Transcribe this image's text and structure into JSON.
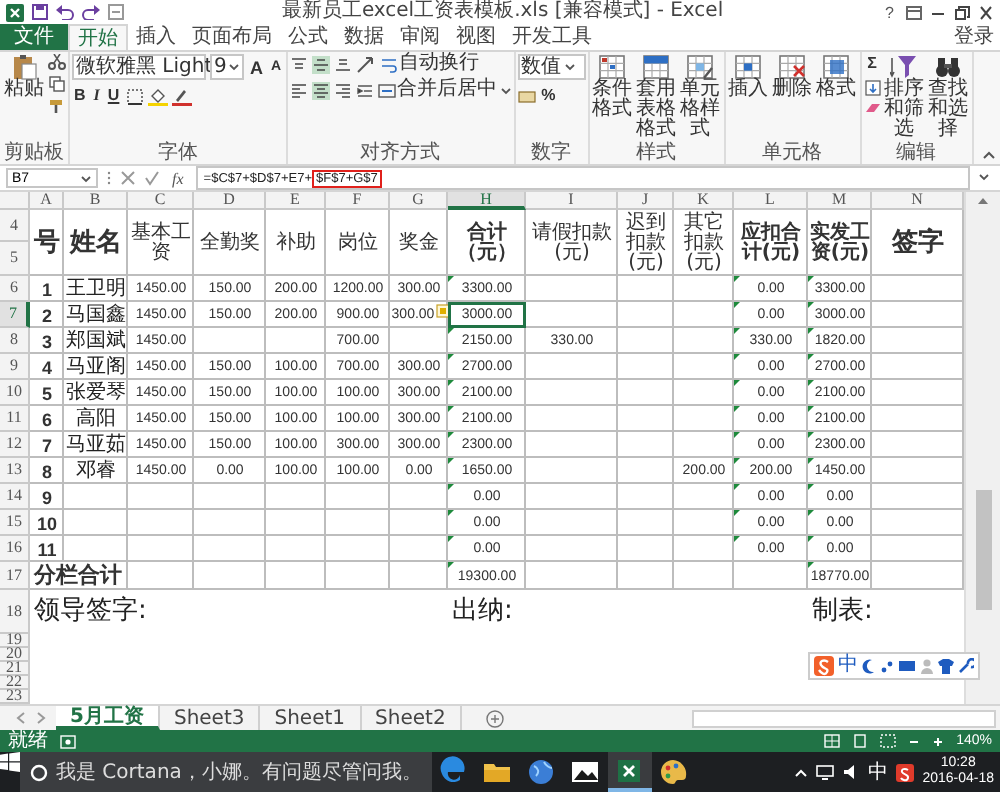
{
  "window": {
    "title": "最新员工excel工资表模板.xls [兼容模式] - Excel",
    "help": "?"
  },
  "ribbon": {
    "tabs": [
      {
        "label": "文件",
        "kind": "file",
        "selected": false
      },
      {
        "label": "开始",
        "kind": "tab",
        "selected": true
      },
      {
        "label": "插入",
        "kind": "tab",
        "selected": false
      },
      {
        "label": "页面布局",
        "kind": "tab",
        "selected": false
      },
      {
        "label": "公式",
        "kind": "tab",
        "selected": false
      },
      {
        "label": "数据",
        "kind": "tab",
        "selected": false
      },
      {
        "label": "审阅",
        "kind": "tab",
        "selected": false
      },
      {
        "label": "视图",
        "kind": "tab",
        "selected": false
      },
      {
        "label": "开发工具",
        "kind": "tab",
        "selected": false
      }
    ],
    "sign_in": "登录",
    "groups": [
      {
        "kind": "clipboard",
        "label": "剪贴板",
        "buttons": [
          "粘贴"
        ]
      },
      {
        "kind": "font",
        "label": "字体",
        "font": "微软雅黑 Light",
        "size": "9",
        "size_buttons": [
          "A",
          "A"
        ],
        "style_buttons": [
          "B",
          "I",
          "U"
        ]
      },
      {
        "kind": "alignment",
        "label": "对齐方式",
        "vertical": [
          {
            "kind": "top",
            "selected": false
          },
          {
            "kind": "middle",
            "selected": true
          },
          {
            "kind": "bottom",
            "selected": false
          }
        ],
        "horizontal": [
          {
            "kind": "left",
            "selected": false
          },
          {
            "kind": "center",
            "selected": true
          },
          {
            "kind": "right",
            "selected": false
          }
        ],
        "buttons": [
          "自动换行",
          "合并后居中"
        ]
      },
      {
        "kind": "number",
        "label": "数字",
        "format": "数值",
        "symbols": [
          "%"
        ]
      },
      {
        "kind": "styles",
        "label": "样式",
        "buttons": [
          "条件格式",
          "套用表格格式",
          "单元格样式"
        ]
      },
      {
        "kind": "cells",
        "label": "单元格",
        "buttons": [
          "插入",
          "删除",
          "格式"
        ]
      },
      {
        "kind": "editing",
        "label": "编辑",
        "symbols": [
          "Σ"
        ],
        "buttons": [
          "排序和筛选",
          "查找和选择"
        ]
      }
    ]
  },
  "formula_bar": {
    "name_box": "B7",
    "function_label": "fx",
    "formula": "=$C$7+$D$7+E7+",
    "highlighted": "$F$7+G$7"
  },
  "sheet": {
    "columns": [
      {
        "label": "A",
        "selected": false
      },
      {
        "label": "B",
        "selected": false
      },
      {
        "label": "C",
        "selected": false
      },
      {
        "label": "D",
        "selected": false
      },
      {
        "label": "E",
        "selected": false
      },
      {
        "label": "F",
        "selected": false
      },
      {
        "label": "G",
        "selected": false
      },
      {
        "label": "H",
        "selected": true
      },
      {
        "label": "I",
        "selected": false
      },
      {
        "label": "J",
        "selected": false
      },
      {
        "label": "K",
        "selected": false
      },
      {
        "label": "L",
        "selected": false
      },
      {
        "label": "M",
        "selected": false
      },
      {
        "label": "N",
        "selected": false
      }
    ],
    "header": {
      "rows": [
        {
          "label": "4",
          "selected": false
        },
        {
          "label": "5",
          "selected": false
        }
      ],
      "cells": {
        "A": "号",
        "B": "姓名",
        "C": "基本工资",
        "D": "全勤奖",
        "E": "补助",
        "F": "岗位",
        "G": "奖金",
        "H": "合计（元）",
        "I": "请假扣款(元)",
        "J": "迟到扣款(元)",
        "K": "其它扣款(元)",
        "L": "应扣合计(元)",
        "M": "实发工资(元)",
        "N": "签字"
      }
    },
    "rows": [
      {
        "label": "6",
        "kind": "data",
        "selected": false,
        "flags": {
          "H": true,
          "L": true,
          "M": true
        },
        "cells": {
          "A": "1",
          "B": "王卫明",
          "C": "1450.00",
          "D": "150.00",
          "E": "200.00",
          "F": "1200.00",
          "G": "300.00",
          "H": "3300.00",
          "L": "0.00",
          "M": "3300.00"
        }
      },
      {
        "label": "7",
        "kind": "data",
        "selected": true,
        "paste_options": true,
        "flags": {
          "H": false,
          "L": true,
          "M": true
        },
        "cells": {
          "A": "2",
          "B": "马国鑫",
          "C": "1450.00",
          "D": "150.00",
          "E": "200.00",
          "F": "900.00",
          "G": "300.00",
          "H": "3000.00",
          "L": "0.00",
          "M": "3000.00"
        }
      },
      {
        "label": "8",
        "kind": "data",
        "selected": false,
        "flags": {
          "H": true,
          "L": true,
          "M": true
        },
        "cells": {
          "A": "3",
          "B": "郑国斌",
          "C": "1450.00",
          "F": "700.00",
          "H": "2150.00",
          "I": "330.00",
          "L": "330.00",
          "M": "1820.00"
        }
      },
      {
        "label": "9",
        "kind": "data",
        "selected": false,
        "flags": {
          "H": true,
          "L": true,
          "M": true
        },
        "cells": {
          "A": "4",
          "B": "马亚阁",
          "C": "1450.00",
          "D": "150.00",
          "E": "100.00",
          "F": "700.00",
          "G": "300.00",
          "H": "2700.00",
          "L": "0.00",
          "M": "2700.00"
        }
      },
      {
        "label": "10",
        "kind": "data",
        "selected": false,
        "flags": {
          "H": true,
          "L": true,
          "M": true
        },
        "cells": {
          "A": "5",
          "B": "张爱琴",
          "C": "1450.00",
          "D": "150.00",
          "E": "100.00",
          "F": "100.00",
          "G": "300.00",
          "H": "2100.00",
          "L": "0.00",
          "M": "2100.00"
        }
      },
      {
        "label": "11",
        "kind": "data",
        "selected": false,
        "flags": {
          "H": true,
          "L": true,
          "M": true
        },
        "cells": {
          "A": "6",
          "B": "高阳",
          "C": "1450.00",
          "D": "150.00",
          "E": "100.00",
          "F": "100.00",
          "G": "300.00",
          "H": "2100.00",
          "L": "0.00",
          "M": "2100.00"
        }
      },
      {
        "label": "12",
        "kind": "data",
        "selected": false,
        "flags": {
          "H": true,
          "L": true,
          "M": true
        },
        "cells": {
          "A": "7",
          "B": "马亚茹",
          "C": "1450.00",
          "D": "150.00",
          "E": "100.00",
          "F": "300.00",
          "G": "300.00",
          "H": "2300.00",
          "L": "0.00",
          "M": "2300.00"
        }
      },
      {
        "label": "13",
        "kind": "data",
        "selected": false,
        "flags": {
          "H": true,
          "L": true,
          "M": true
        },
        "cells": {
          "A": "8",
          "B": "邓睿",
          "C": "1450.00",
          "D": "0.00",
          "E": "100.00",
          "F": "100.00",
          "G": "0.00",
          "H": "1650.00",
          "K": "200.00",
          "L": "200.00",
          "M": "1450.00"
        }
      },
      {
        "label": "14",
        "kind": "data",
        "selected": false,
        "flags": {
          "H": true,
          "L": true,
          "M": true
        },
        "cells": {
          "A": "9",
          "H": "0.00",
          "L": "0.00",
          "M": "0.00"
        }
      },
      {
        "label": "15",
        "kind": "data",
        "selected": false,
        "flags": {
          "H": true,
          "L": true,
          "M": true
        },
        "cells": {
          "A": "10",
          "H": "0.00",
          "L": "0.00",
          "M": "0.00"
        }
      },
      {
        "label": "16",
        "kind": "data",
        "selected": false,
        "flags": {
          "H": true,
          "L": true,
          "M": true
        },
        "cells": {
          "A": "11",
          "H": "0.00",
          "L": "0.00",
          "M": "0.00"
        }
      },
      {
        "label": "17",
        "kind": "total",
        "selected": false,
        "flags": {
          "H": true,
          "M": true
        },
        "cells": {
          "A": "分栏合计",
          "H": "19300.00",
          "M": "18770.00"
        }
      },
      {
        "label": "18",
        "kind": "signature",
        "selected": false,
        "cells": {
          "A": "领导签字:",
          "H": "出纳:",
          "M": "制表:"
        }
      },
      {
        "label": "19",
        "kind": "blank",
        "selected": false
      },
      {
        "label": "20",
        "kind": "blank",
        "selected": false
      },
      {
        "label": "21",
        "kind": "blank",
        "selected": false
      },
      {
        "label": "22",
        "kind": "blank",
        "selected": false
      },
      {
        "label": "23",
        "kind": "blank",
        "selected": false
      }
    ],
    "ime_toolbar": {
      "mode": "中"
    }
  },
  "sheet_tabs": [
    {
      "label": "5月工资",
      "selected": true
    },
    {
      "label": "Sheet3",
      "selected": false
    },
    {
      "label": "Sheet1",
      "selected": false
    },
    {
      "label": "Sheet2",
      "selected": false
    }
  ],
  "status_bar": {
    "text": "就绪",
    "zoom": "140%"
  },
  "taskbar": {
    "search": "我是 Cortana，小娜。有问题尽管问我。",
    "apps": [
      {
        "kind": "edge",
        "active": false
      },
      {
        "kind": "explorer",
        "active": false
      },
      {
        "kind": "globe",
        "active": false
      },
      {
        "kind": "photos",
        "active": false
      },
      {
        "kind": "excel",
        "active": true
      },
      {
        "kind": "paint",
        "active": false
      }
    ],
    "ime": "中",
    "time": "10:28",
    "date": "2016-04-18"
  }
}
